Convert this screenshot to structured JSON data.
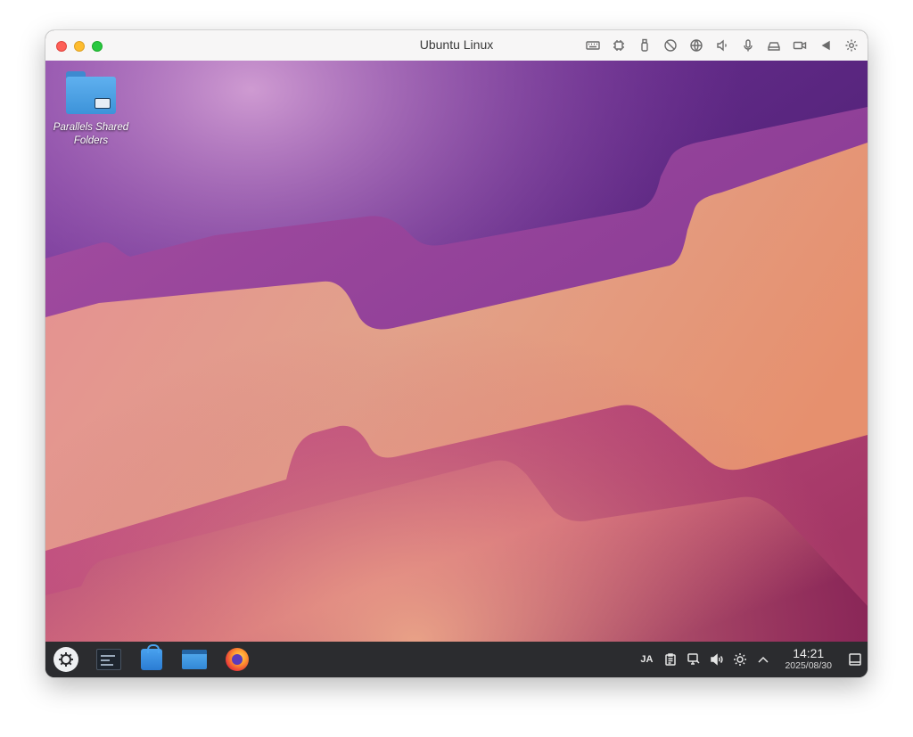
{
  "window": {
    "title": "Ubuntu Linux"
  },
  "titlebar_icons": [
    "keyboard-icon",
    "cpu-icon",
    "usb-icon",
    "no-camera-icon",
    "network-icon",
    "volume-icon",
    "microphone-icon",
    "drive-icon",
    "camera-icon",
    "play-left-icon",
    "settings-gear-icon"
  ],
  "desktop": {
    "icons": [
      {
        "label": "Parallels Shared Folders",
        "icon": "folder-icon"
      }
    ]
  },
  "taskbar": {
    "apps": [
      "app-launcher-icon",
      "system-monitor-icon",
      "software-store-icon",
      "file-manager-icon",
      "firefox-icon"
    ],
    "tray": {
      "input_method": "JA",
      "clock_time": "14:21",
      "clock_date": "2025/08/30"
    }
  },
  "colors": {
    "titlebar": "#f7f6f6",
    "taskbar": "#2b2c2f",
    "accent_purple": "#6a2f8a",
    "accent_peach": "#e0977a"
  }
}
